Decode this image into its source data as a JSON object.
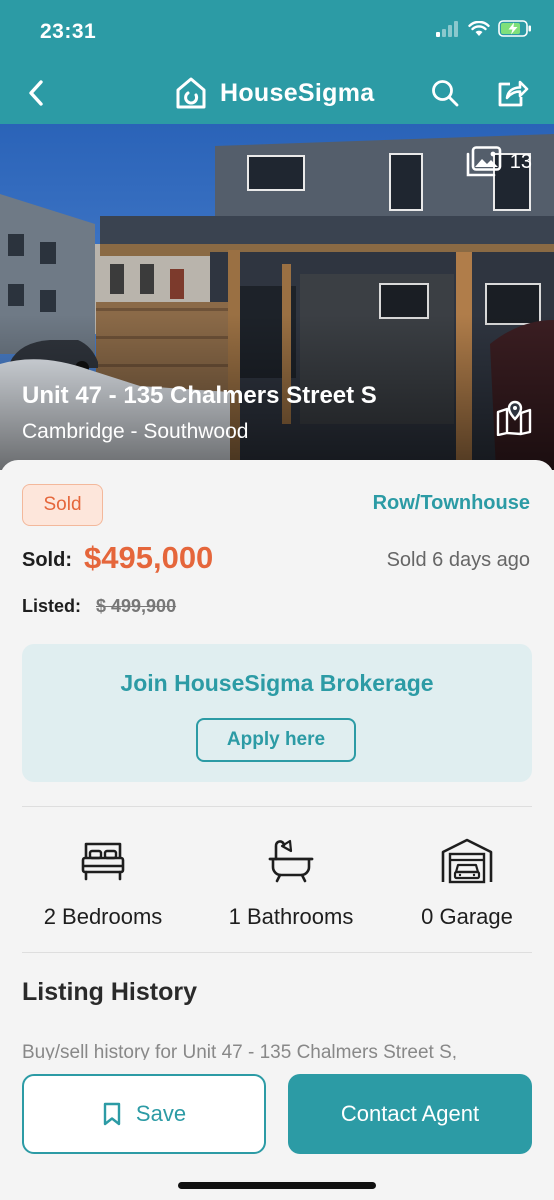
{
  "status_bar": {
    "time": "23:31"
  },
  "nav": {
    "brand": "HouseSigma"
  },
  "hero": {
    "photo_count": "13",
    "title": "Unit 47 - 135 Chalmers Street S",
    "subtitle": "Cambridge - Southwood"
  },
  "summary": {
    "status_badge": "Sold",
    "property_type": "Row/Townhouse",
    "sold_label": "Sold:",
    "sold_price": "$495,000",
    "sold_ago": "Sold 6 days ago",
    "listed_label": "Listed:",
    "listed_price": "$ 499,900"
  },
  "promo": {
    "title": "Join HouseSigma Brokerage",
    "button": "Apply here"
  },
  "features": [
    {
      "icon": "bed-icon",
      "label": "2 Bedrooms"
    },
    {
      "icon": "bathtub-icon",
      "label": "1 Bathrooms"
    },
    {
      "icon": "garage-icon",
      "label": "0 Garage"
    }
  ],
  "listing_history": {
    "title": "Listing History",
    "description": "Buy/sell history for Unit 47 - 135 Chalmers Street S,"
  },
  "actions": {
    "save": "Save",
    "contact": "Contact Agent"
  },
  "colors": {
    "brand": "#2c9ba5",
    "sold_accent": "#e5663b",
    "promo_bg": "#e0eef0"
  }
}
